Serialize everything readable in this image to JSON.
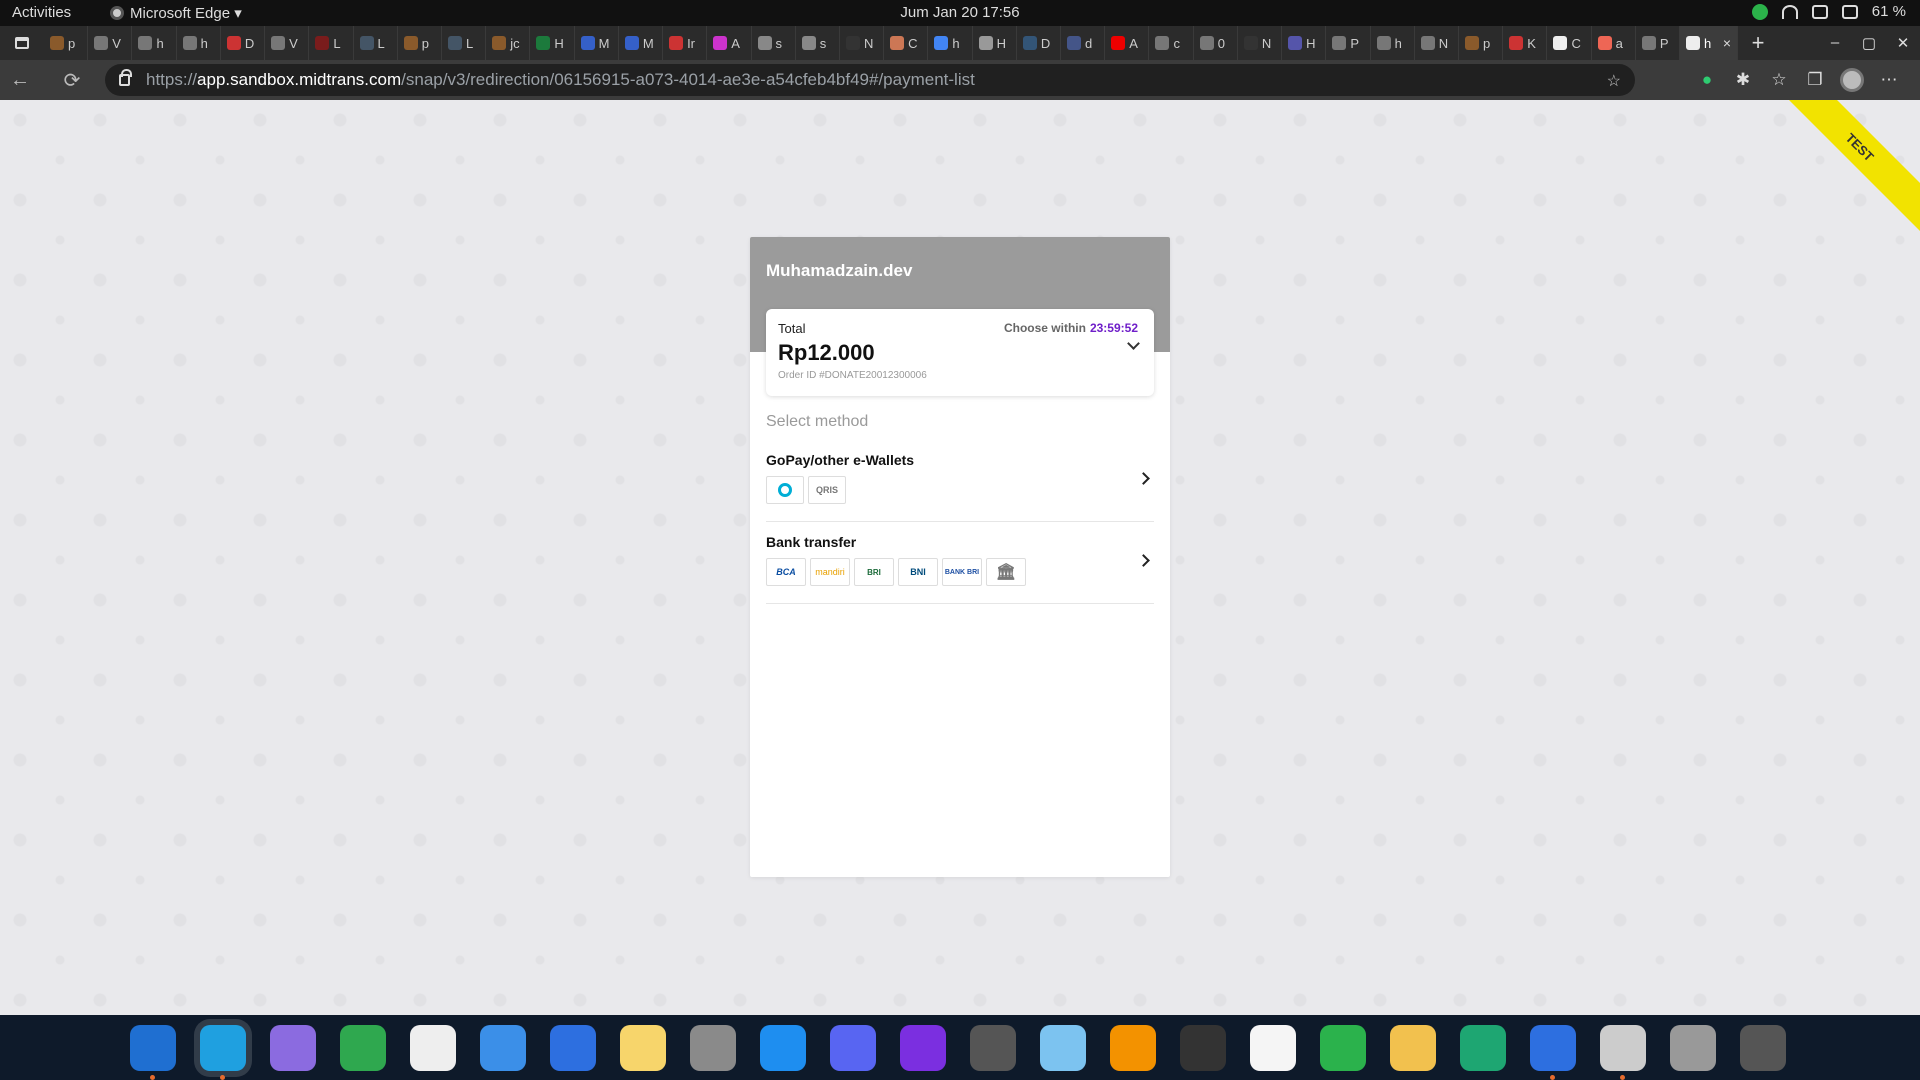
{
  "topbar": {
    "activities": "Activities",
    "app_name": "Microsoft Edge ▾",
    "clock": "Jum Jan 20  17:56",
    "battery": "61 %"
  },
  "tabs": [
    {
      "label": "p",
      "color": "#8a5a2b"
    },
    {
      "label": "V",
      "color": "#777"
    },
    {
      "label": "h",
      "color": "#777"
    },
    {
      "label": "h",
      "color": "#777"
    },
    {
      "label": "D",
      "color": "#c33"
    },
    {
      "label": "V",
      "color": "#777"
    },
    {
      "label": "L",
      "color": "#7a1c1c"
    },
    {
      "label": "L",
      "color": "#456"
    },
    {
      "label": "p",
      "color": "#8a5a2b"
    },
    {
      "label": "L",
      "color": "#456"
    },
    {
      "label": "jc",
      "color": "#8a5a2b"
    },
    {
      "label": "H",
      "color": "#1c7a3c"
    },
    {
      "label": "M",
      "color": "#3560c9"
    },
    {
      "label": "M",
      "color": "#3560c9"
    },
    {
      "label": "Ir",
      "color": "#c33"
    },
    {
      "label": "A",
      "color": "#c3c"
    },
    {
      "label": "s",
      "color": "#888"
    },
    {
      "label": "s",
      "color": "#888"
    },
    {
      "label": "N",
      "color": "#333"
    },
    {
      "label": "C",
      "color": "#c75"
    },
    {
      "label": "h",
      "color": "#4285f4"
    },
    {
      "label": "H",
      "color": "#999"
    },
    {
      "label": "D",
      "color": "#357"
    },
    {
      "label": "d",
      "color": "#458"
    },
    {
      "label": "A",
      "color": "#e00"
    },
    {
      "label": "c",
      "color": "#777"
    },
    {
      "label": "0",
      "color": "#777"
    },
    {
      "label": "N",
      "color": "#333"
    },
    {
      "label": "H",
      "color": "#55a"
    },
    {
      "label": "P",
      "color": "#777"
    },
    {
      "label": "h",
      "color": "#777"
    },
    {
      "label": "N",
      "color": "#777"
    },
    {
      "label": "p",
      "color": "#8a5a2b"
    },
    {
      "label": "K",
      "color": "#c33"
    },
    {
      "label": "C",
      "color": "#eee"
    },
    {
      "label": "a",
      "color": "#e65"
    },
    {
      "label": "P",
      "color": "#777"
    }
  ],
  "active_tab": {
    "label": "h",
    "close": "×"
  },
  "newtab": "+",
  "window_controls": {
    "minimize": "–",
    "maximize": "▢",
    "close": "✕"
  },
  "address": {
    "scheme": "https://",
    "host": "app.sandbox.midtrans.com",
    "path": "/snap/v3/redirection/06156915-a073-4014-ae3e-a54cfeb4bf49#/payment-list"
  },
  "nav": {
    "back": "←",
    "reload": "⟳",
    "star": "☆",
    "more": "⋯"
  },
  "ribbon": "TEST",
  "card": {
    "merchant": "Muhamadzain.dev",
    "total_label": "Total",
    "choose_label": "Choose within",
    "timer": "23:59:52",
    "amount": "Rp12.000",
    "order_id": "Order ID #DONATE20012300006",
    "select_method": "Select method",
    "methods": [
      {
        "name": "GoPay/other e-Wallets",
        "logos": [
          "gopay",
          "QRIS"
        ]
      },
      {
        "name": "Bank transfer",
        "logos": [
          "BCA",
          "mandiri",
          "BRI",
          "BNI",
          "BANK BRI",
          "bank"
        ]
      }
    ]
  },
  "dock_apps": [
    "vscode",
    "edge",
    "app-purple",
    "chat",
    "app-white",
    "finder",
    "app-blue",
    "notes",
    "settings",
    "app-store",
    "discord",
    "app-violet",
    "screenshot",
    "files",
    "vlc",
    "terminal",
    "keynote",
    "numbers",
    "pages",
    "app-green",
    "app-blue-2",
    "screenshot-2",
    "disk",
    "app-grid"
  ],
  "colors": {
    "accent_timer": "#6f1ec9",
    "header_bg": "#9b9b9b",
    "test_ribbon": "#f2e300"
  }
}
